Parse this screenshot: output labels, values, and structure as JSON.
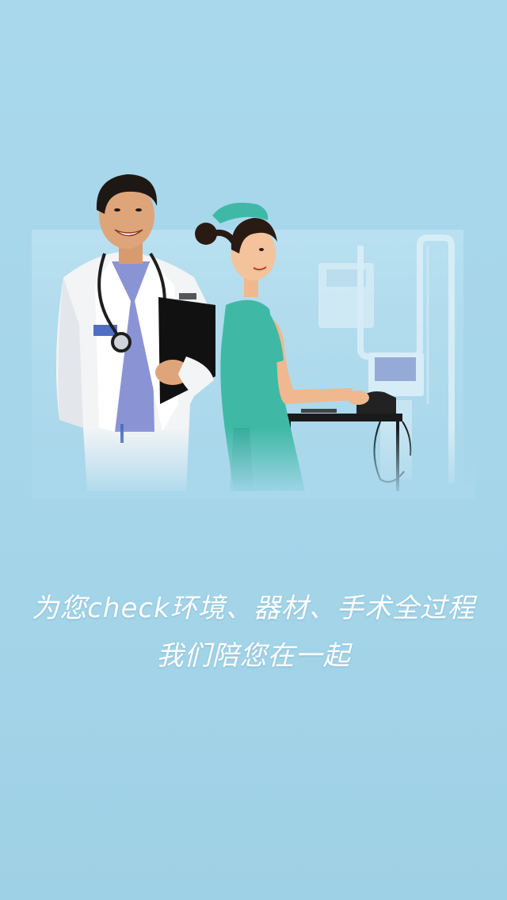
{
  "splash": {
    "tagline_line1": "为您check环境、器材、手术全过程",
    "tagline_line2": "我们陪您在一起"
  },
  "colors": {
    "background": "#a9d8ec",
    "text": "#ffffff",
    "nurse_uniform": "#3fb9a6"
  },
  "icons": {
    "illustration": "doctor-and-nurse-illustration"
  }
}
